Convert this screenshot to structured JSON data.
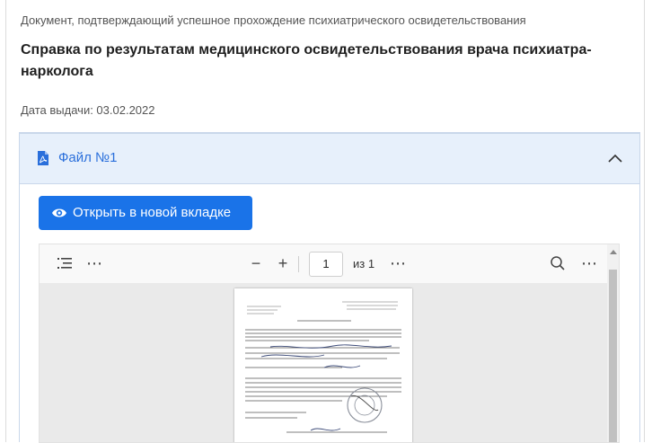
{
  "document": {
    "type_label": "Документ, подтверждающий успешное прохождение психиатрического освидетельствования",
    "title": "Справка по результатам медицинского освидетельствования врача психиатра-нарколога",
    "issue_date": "Дата выдачи: 03.02.2022"
  },
  "attachment": {
    "file_label": "Файл №1",
    "expanded": true,
    "open_button_label": "Открыть в новой вкладке"
  },
  "viewer": {
    "current_page": "1",
    "page_count_label": "из 1",
    "icons": [
      "outline-icon",
      "more-icon",
      "zoom-out-icon",
      "zoom-in-icon",
      "search-icon",
      "more-icon"
    ]
  },
  "colors": {
    "accent": "#1a73e8",
    "link": "#2a6fdb",
    "accordion_header_bg": "#e7f0fb"
  }
}
